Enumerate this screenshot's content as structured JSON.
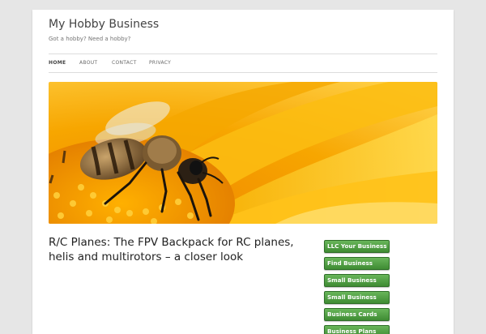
{
  "site": {
    "title": "My Hobby Business",
    "tagline": "Got a hobby? Need a hobby?"
  },
  "nav": {
    "items": [
      {
        "label": "HOME",
        "active": true
      },
      {
        "label": "ABOUT",
        "active": false
      },
      {
        "label": "CONTACT",
        "active": false
      },
      {
        "label": "PRIVACY",
        "active": false
      }
    ]
  },
  "header_image": {
    "icon": "bee-on-flower-image",
    "colors": {
      "petal": "#f7b500",
      "center": "#f59c00",
      "bee": "#3a2a1a"
    }
  },
  "post": {
    "title": "R/C Planes: The FPV Backpack for RC planes, helis and multirotors – a closer look"
  },
  "sidebar": {
    "buttons": [
      "LLC Your Business",
      "Find Business",
      "Small Business",
      "Small Business",
      "Business Cards",
      "Business Plans"
    ],
    "colors": {
      "button_top": "#68b55a",
      "button_bottom": "#3e8b33"
    }
  },
  "colors": {
    "page_bg": "#e6e6e6",
    "content_bg": "#ffffff"
  }
}
